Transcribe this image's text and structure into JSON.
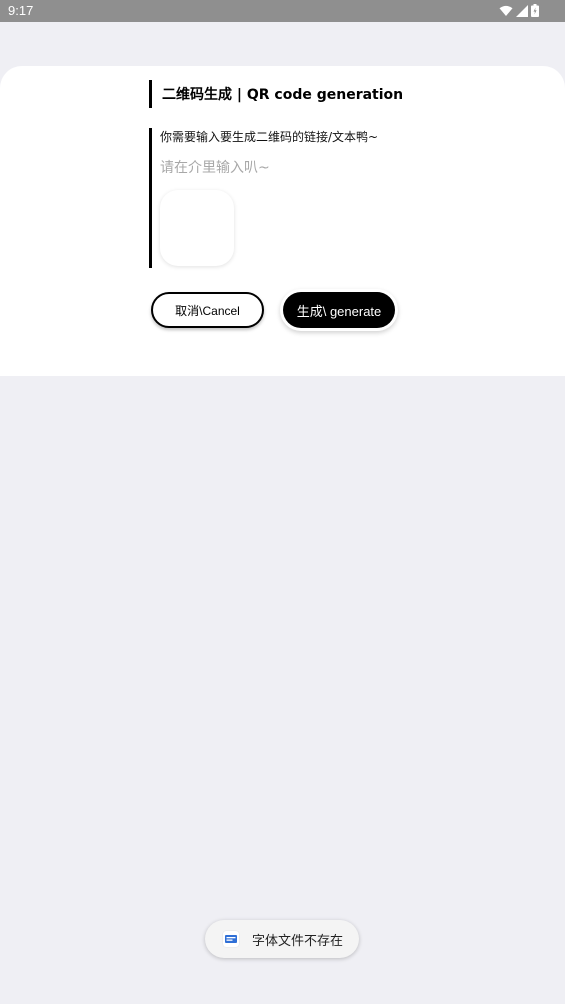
{
  "status_bar": {
    "time": "9:17",
    "icons": [
      "wifi-icon",
      "signal-icon",
      "battery-icon"
    ]
  },
  "dialog": {
    "title": "二维码生成 | QR code generation",
    "prompt": "你需要输入要生成二维码的链接/文本鸭~",
    "input": {
      "value": "",
      "placeholder": "请在介里输入叭~"
    },
    "cancel_label": "取消\\Cancel",
    "generate_label": "生成\\ generate"
  },
  "toast": {
    "icon": "app-icon",
    "message": "字体文件不存在"
  },
  "colors": {
    "background": "#efeff4",
    "status_bar": "#8f8f8f",
    "accent": "#000000",
    "card": "#ffffff"
  }
}
